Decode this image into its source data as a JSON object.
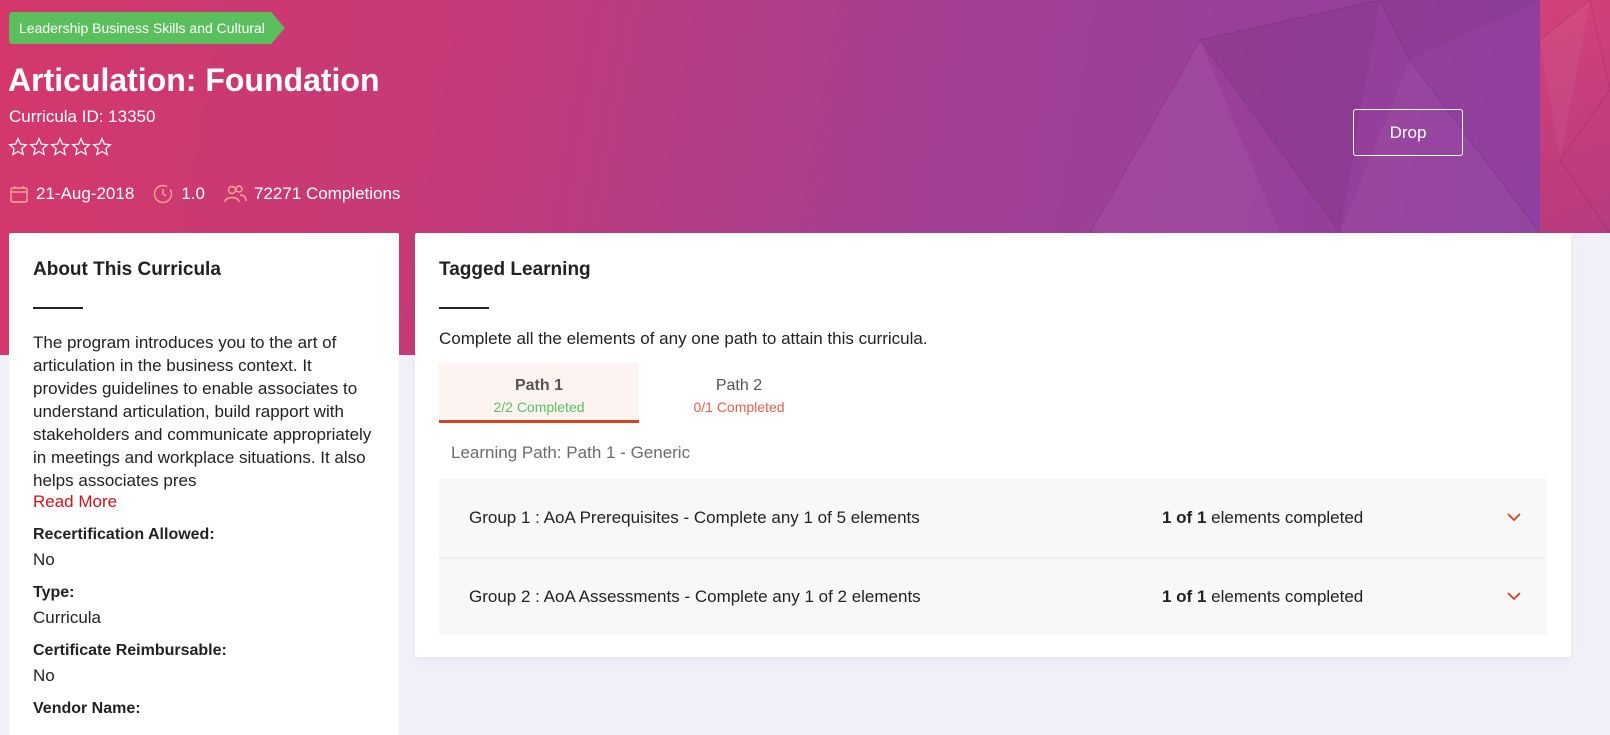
{
  "header": {
    "category_tag": "Leadership Business Skills and Cultural",
    "title": "Articulation: Foundation",
    "curricula_id": "Curricula ID: 13350",
    "rating": 0,
    "rating_max": 5,
    "date": "21-Aug-2018",
    "duration": "1.0",
    "completions": "72271 Completions",
    "drop_label": "Drop"
  },
  "about": {
    "heading": "About This Curricula",
    "description": "The program introduces you to the art of articulation in the business context. It provides guidelines to enable associates to understand articulation, build rapport with stakeholders and communicate appropriately in meetings and workplace situations. It also helps associates pres",
    "read_more": "Read More",
    "fields": [
      {
        "label": "Recertification Allowed:",
        "value": "No"
      },
      {
        "label": "Type:",
        "value": "Curricula"
      },
      {
        "label": "Certificate Reimbursable:",
        "value": "No"
      },
      {
        "label": "Vendor Name:",
        "value": ""
      }
    ]
  },
  "tagged": {
    "heading": "Tagged Learning",
    "instruction": "Complete all the elements of any one path to attain this curricula.",
    "tabs": [
      {
        "label": "Path 1",
        "status": "2/2 Completed",
        "active": true
      },
      {
        "label": "Path 2",
        "status": "0/1 Completed",
        "active": false
      }
    ],
    "path_label": "Learning Path: Path 1 - Generic",
    "groups": [
      {
        "name": "Group 1 : AoA Prerequisites - Complete any 1 of 5 elements",
        "count": "1 of 1",
        "suffix": " elements completed"
      },
      {
        "name": "Group 2 : AoA Assessments - Complete any 1 of 2 elements",
        "count": "1 of 1",
        "suffix": " elements completed"
      }
    ]
  },
  "colors": {
    "tag_green": "#5bbf5e",
    "accent_red": "#d6421f",
    "link_red": "#d0121b",
    "hero_pink": "#d4386b",
    "hero_purple": "#8e3f9f"
  }
}
